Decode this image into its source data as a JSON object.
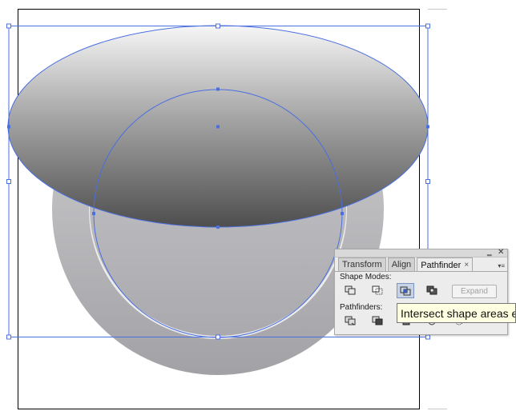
{
  "panel": {
    "minimize_label": "‗",
    "close_label": "✕",
    "tabs": [
      {
        "label": "Transform"
      },
      {
        "label": "Align"
      },
      {
        "label": "Pathfinder",
        "active": true
      }
    ],
    "tab_close_label": "×",
    "menu_icon": "▾≡",
    "shape_modes_label": "Shape Modes:",
    "pathfinders_label": "Pathfinders:",
    "expand_label": "Expand",
    "shape_mode_buttons": [
      "unite-icon",
      "minus-front-icon",
      "intersect-icon",
      "exclude-icon"
    ],
    "pathfinder_buttons": [
      "divide-icon",
      "trim-icon",
      "merge-icon",
      "crop-icon",
      "outline-icon",
      "minus-back-icon"
    ]
  },
  "tooltip": {
    "text": "Intersect shape areas e"
  },
  "colors": {
    "selection": "#4a6fe0",
    "panel_bg": "#ececec",
    "tooltip_bg": "#ffffe1"
  }
}
